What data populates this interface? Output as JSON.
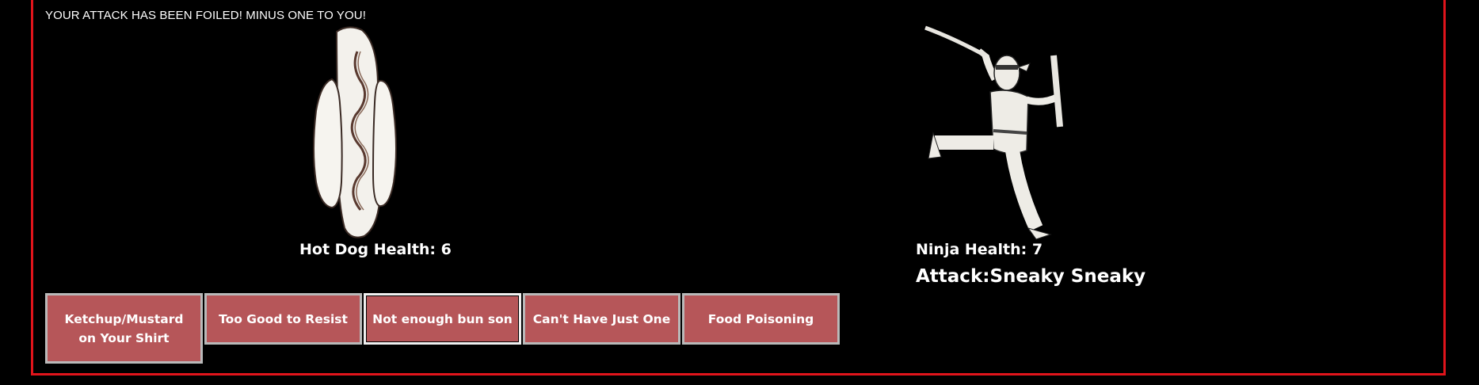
{
  "game": {
    "message": "YOUR ATTACK HAS BEEN FOILED! MINUS ONE TO YOU!",
    "player": {
      "name": "Hot Dog",
      "health_label": "Hot Dog Health: 6",
      "health": 6
    },
    "enemy": {
      "name": "Ninja",
      "health_label": "Ninja Health: 7",
      "health": 7,
      "attack_label": "Attack:Sneaky Sneaky"
    },
    "attacks": [
      {
        "label": "Ketchup/Mustard on Your Shirt"
      },
      {
        "label": "Too Good to Resist"
      },
      {
        "label": "Not enough bun son"
      },
      {
        "label": "Can't Have Just One"
      },
      {
        "label": "Food Poisoning"
      }
    ],
    "colors": {
      "frame": "#e0141b",
      "button": "#b65659",
      "background": "#000000"
    }
  }
}
